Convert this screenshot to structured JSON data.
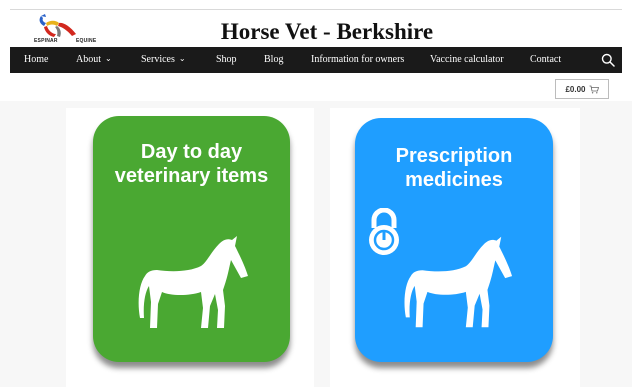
{
  "site": {
    "title": "Horse Vet - Berkshire",
    "logo_text_left": "ESPINAR",
    "logo_text_right": "EQUINE"
  },
  "nav": {
    "items": [
      {
        "label": "Home",
        "has_dropdown": false
      },
      {
        "label": "About",
        "has_dropdown": true
      },
      {
        "label": "Services",
        "has_dropdown": true
      },
      {
        "label": "Shop",
        "has_dropdown": false
      },
      {
        "label": "Blog",
        "has_dropdown": false
      },
      {
        "label": "Information for owners",
        "has_dropdown": false
      },
      {
        "label": "Vaccine calculator",
        "has_dropdown": false
      },
      {
        "label": "Contact",
        "has_dropdown": false
      }
    ],
    "dropdown_icon": "chevron-down-icon",
    "search_icon": "search-icon"
  },
  "cart": {
    "amount": "£0.00",
    "icon": "cart-icon"
  },
  "categories": [
    {
      "title_line1": "Day to day",
      "title_line2": "veterinary items",
      "color": "#4aa832",
      "icon": "horse-icon"
    },
    {
      "title_line1": "Prescription",
      "title_line2": "medicines",
      "color": "#1f9eff",
      "icon": "horse-icon",
      "extra_icon": "padlock-icon"
    }
  ],
  "colors": {
    "navbar_bg": "#1a1a1a",
    "page_bg": "#ffffff",
    "content_bg": "#f7f7f7"
  }
}
